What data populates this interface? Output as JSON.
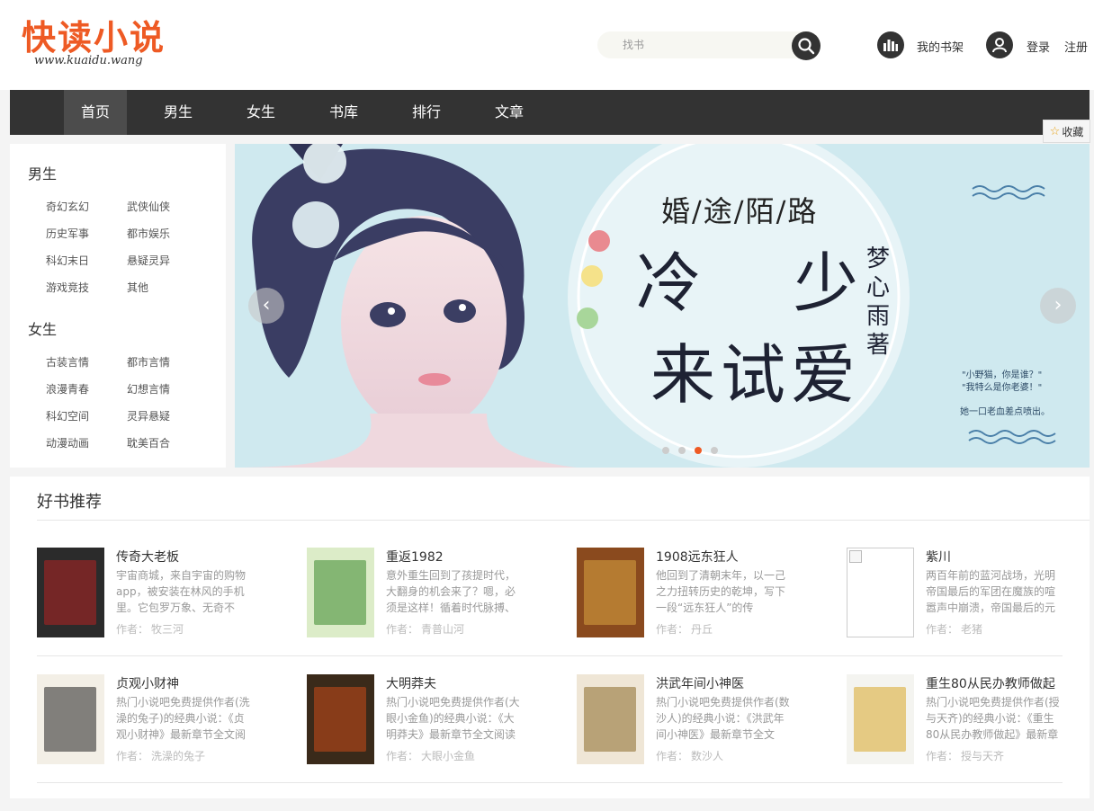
{
  "logo": {
    "main": "快读小说",
    "sub": "www.kuaidu.wang"
  },
  "search": {
    "placeholder": "找书"
  },
  "header": {
    "shelf": "我的书架",
    "login": "登录",
    "register": "注册"
  },
  "nav": [
    "首页",
    "男生",
    "女生",
    "书库",
    "排行",
    "文章"
  ],
  "fav": "收藏",
  "sidebar": {
    "male": {
      "title": "男生",
      "links": [
        "奇幻玄幻",
        "武侠仙侠",
        "历史军事",
        "都市娱乐",
        "科幻末日",
        "悬疑灵异",
        "游戏竞技",
        "其他"
      ]
    },
    "female": {
      "title": "女生",
      "links": [
        "古装言情",
        "都市言情",
        "浪漫青春",
        "幻想言情",
        "科幻空间",
        "灵异悬疑",
        "动漫动画",
        "耽美百合"
      ]
    }
  },
  "banner": {
    "top": "婚/途/陌/路",
    "main1": "冷 少",
    "main2": "来试爱",
    "author": "梦心雨著",
    "quote1": "\"小野猫，你是谁？\"",
    "quote2": "\"我特么是你老婆！\"",
    "quote3": "她一口老血差点喷出。"
  },
  "rec": {
    "title": "好书推荐",
    "author_label": "作者：",
    "books": [
      {
        "title": "传奇大老板",
        "desc": "宇宙商城，来自宇宙的购物app，被安装在林风的手机里。它包罗万象、无奇不",
        "author": "牧三河",
        "cover": "#2b2b2b",
        "accent": "#b22222"
      },
      {
        "title": "重返1982",
        "desc": "意外重生回到了孩提时代，大翻身的机会来了？嗯，必须是这样！循着时代脉搏、",
        "author": "青普山河",
        "cover": "#dcecc8",
        "accent": "#3c8a2e"
      },
      {
        "title": "1908远东狂人",
        "desc": "他回到了清朝末年，以一己之力扭转历史的乾坤，写下一段“远东狂人”的传",
        "author": "丹丘",
        "cover": "#8a4a1e",
        "accent": "#d9a441"
      },
      {
        "title": "紫川",
        "desc": "两百年前的蓝河战场，光明帝国最后的军团在魔族的喧嚣声中崩溃，帝国最后的元",
        "author": "老猪",
        "cover": "#ffffff",
        "accent": "#cccccc"
      },
      {
        "title": "贞观小财神",
        "desc": "热门小说吧免费提供作者(洗澡的兔子)的经典小说：《贞观小财神》最新章节全文阅",
        "author": "洗澡的兔子",
        "cover": "#f3efe6",
        "accent": "#222222"
      },
      {
        "title": "大明莽夫",
        "desc": "热门小说吧免费提供作者(大眼小金鱼)的经典小说：《大明莽夫》最新章节全文阅读",
        "author": "大眼小金鱼",
        "cover": "#3a2a1a",
        "accent": "#c84a1a"
      },
      {
        "title": "洪武年间小神医",
        "desc": "热门小说吧免费提供作者(数沙人)的经典小说：《洪武年间小神医》最新章节全文",
        "author": "数沙人",
        "cover": "#efe6d6",
        "accent": "#8a6a2a"
      },
      {
        "title": "重生80从民办教师做起",
        "desc": "热门小说吧免费提供作者(授与天齐)的经典小说：《重生80从民办教师做起》最新章",
        "author": "授与天齐",
        "cover": "#f4f4f0",
        "accent": "#d9a82a"
      }
    ]
  }
}
